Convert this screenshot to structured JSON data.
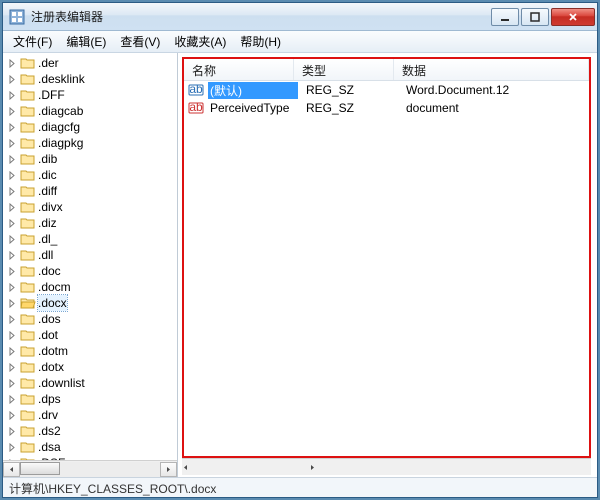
{
  "window": {
    "title": "注册表编辑器"
  },
  "menu": {
    "file": "文件(F)",
    "edit": "编辑(E)",
    "view": "查看(V)",
    "fav": "收藏夹(A)",
    "help": "帮助(H)"
  },
  "tree": {
    "items": [
      ".der",
      ".desklink",
      ".DFF",
      ".diagcab",
      ".diagcfg",
      ".diagpkg",
      ".dib",
      ".dic",
      ".diff",
      ".divx",
      ".diz",
      ".dl_",
      ".dll",
      ".doc",
      ".docm",
      ".docx",
      ".dos",
      ".dot",
      ".dotm",
      ".dotx",
      ".downlist",
      ".dps",
      ".drv",
      ".ds2",
      ".dsa",
      ".DSF"
    ],
    "selected": ".docx"
  },
  "list": {
    "columns": {
      "name": "名称",
      "type": "类型",
      "data": "数据"
    },
    "rows": [
      {
        "name": "(默认)",
        "type": "REG_SZ",
        "data": "Word.Document.12",
        "icon": "string",
        "selected": true
      },
      {
        "name": "PerceivedType",
        "type": "REG_SZ",
        "data": "document",
        "icon": "string-red",
        "selected": false
      }
    ]
  },
  "status": {
    "path": "计算机\\HKEY_CLASSES_ROOT\\.docx"
  }
}
